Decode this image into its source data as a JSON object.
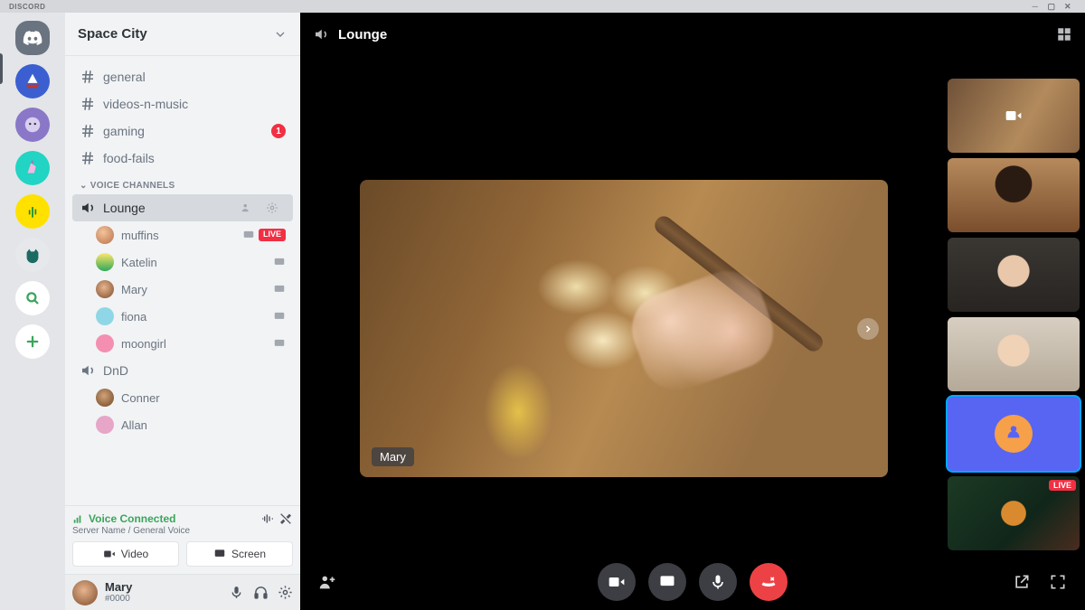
{
  "app_name": "DISCORD",
  "server_name": "Space City",
  "channels": {
    "text": [
      {
        "name": "general",
        "unread": 0
      },
      {
        "name": "videos-n-music",
        "unread": 0
      },
      {
        "name": "gaming",
        "unread": 1
      },
      {
        "name": "food-fails",
        "unread": 0
      }
    ],
    "voice_category_label": "VOICE CHANNELS",
    "voice": [
      {
        "name": "Lounge",
        "active": true,
        "members": [
          {
            "name": "muffins",
            "live": true
          },
          {
            "name": "Katelin"
          },
          {
            "name": "Mary"
          },
          {
            "name": "fiona"
          },
          {
            "name": "moongirl"
          }
        ]
      },
      {
        "name": "DnD",
        "active": false,
        "members": [
          {
            "name": "Conner"
          },
          {
            "name": "Allan"
          }
        ]
      }
    ]
  },
  "voice_status": {
    "title": "Voice Connected",
    "sub": "Server Name / General Voice",
    "video_btn": "Video",
    "screen_btn": "Screen"
  },
  "me": {
    "name": "Mary",
    "tag": "#0000"
  },
  "stage": {
    "channel": "Lounge",
    "speaker_name": "Mary"
  },
  "live_label": "LIVE",
  "unread_count": "1",
  "server_icons": [
    "discord-home",
    "sailboat",
    "moon-face",
    "unicorn",
    "cactus",
    "cat",
    "search",
    "add"
  ]
}
